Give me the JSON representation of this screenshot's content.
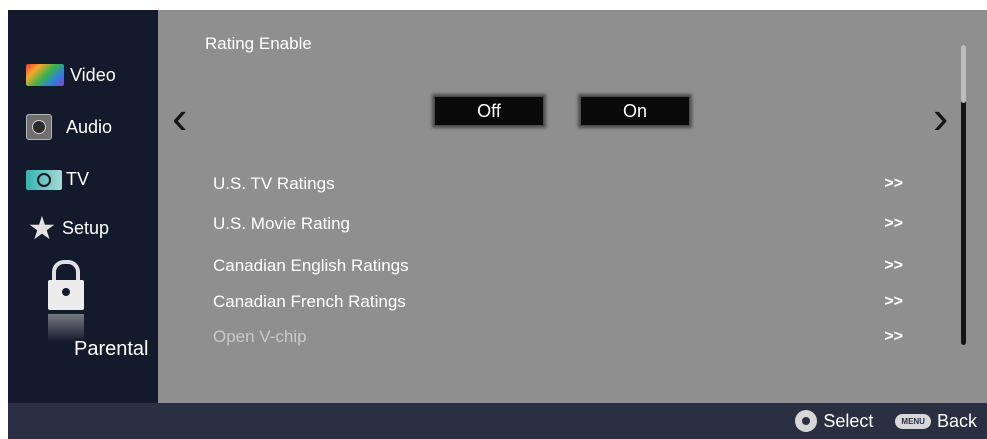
{
  "sidebar": {
    "items": [
      {
        "label": "Video",
        "icon": "video-icon"
      },
      {
        "label": "Audio",
        "icon": "audio-icon"
      },
      {
        "label": "TV",
        "icon": "tv-icon"
      },
      {
        "label": "Setup",
        "icon": "setup-icon"
      },
      {
        "label": "Parental",
        "icon": "lock-icon"
      }
    ]
  },
  "content": {
    "title": "Rating Enable",
    "nav": {
      "left": "‹",
      "right": "›"
    },
    "toggle": {
      "off_label": "Off",
      "on_label": "On"
    },
    "list": [
      {
        "label": "U.S. TV Ratings",
        "chev": ">>"
      },
      {
        "label": "U.S. Movie Rating",
        "chev": ">>"
      },
      {
        "label": "Canadian English Ratings",
        "chev": ">>"
      },
      {
        "label": "Canadian French Ratings",
        "chev": ">>"
      },
      {
        "label": "Open V-chip",
        "chev": ">>"
      }
    ]
  },
  "footer": {
    "select_label": "Select",
    "menu_badge": "MENU",
    "back_label": "Back"
  }
}
